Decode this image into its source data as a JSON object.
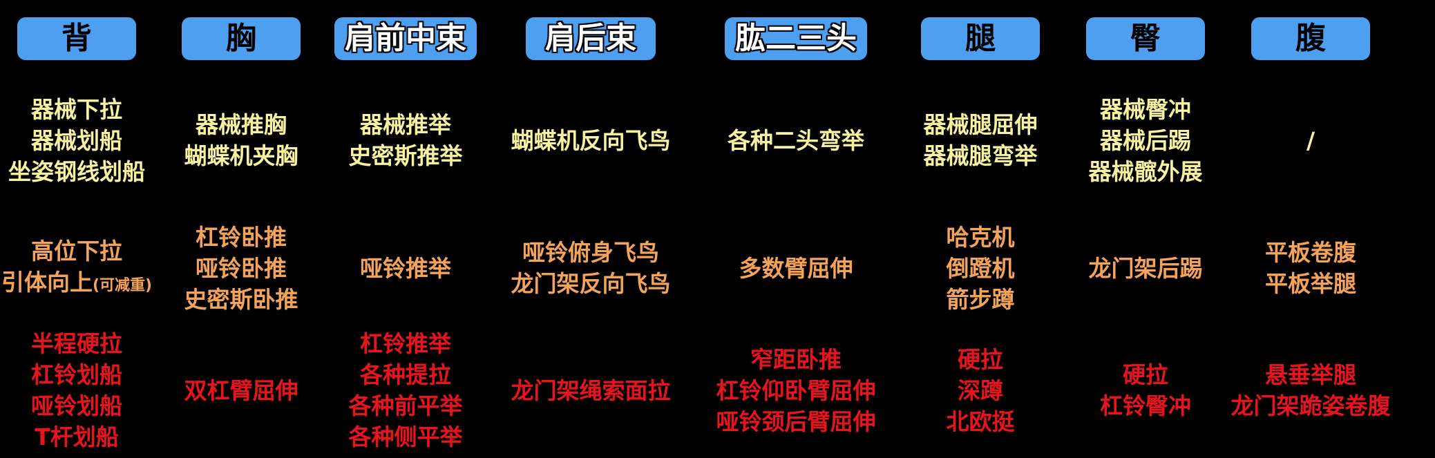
{
  "colors": {
    "background": "#000000",
    "header_bg": "#4f9ff0",
    "row1_text": "#f7f1a0",
    "row2_text": "#f4a45a",
    "row3_text": "#e8141d"
  },
  "columns": [
    {
      "header": "背",
      "row1": [
        "器械下拉",
        "器械划船",
        "坐姿钢线划船"
      ],
      "row2": [
        "高位下拉",
        "引体向上"
      ],
      "row2_note": "(可减重)",
      "row3": [
        "半程硬拉",
        "杠铃划船",
        "哑铃划船",
        "T杆划船"
      ]
    },
    {
      "header": "胸",
      "row1": [
        "器械推胸",
        "蝴蝶机夹胸"
      ],
      "row2": [
        "杠铃卧推",
        "哑铃卧推",
        "史密斯卧推"
      ],
      "row3": [
        "双杠臂屈伸"
      ]
    },
    {
      "header": "肩前中束",
      "row1": [
        "器械推举",
        "史密斯推举"
      ],
      "row2": [
        "哑铃推举"
      ],
      "row3": [
        "杠铃推举",
        "各种提拉",
        "各种前平举",
        "各种侧平举"
      ]
    },
    {
      "header": "肩后束",
      "row1": [
        "蝴蝶机反向飞鸟"
      ],
      "row2": [
        "哑铃俯身飞鸟",
        "龙门架反向飞鸟"
      ],
      "row3": [
        "龙门架绳索面拉"
      ]
    },
    {
      "header": "肱二三头",
      "row1": [
        "各种二头弯举"
      ],
      "row2": [
        "多数臂屈伸"
      ],
      "row3": [
        "窄距卧推",
        "杠铃仰卧臂屈伸",
        "哑铃颈后臂屈伸"
      ]
    },
    {
      "header": "腿",
      "row1": [
        "器械腿屈伸",
        "器械腿弯举"
      ],
      "row2": [
        "哈克机",
        "倒蹬机",
        "箭步蹲"
      ],
      "row3": [
        "硬拉",
        "深蹲",
        "北欧挺"
      ]
    },
    {
      "header": "臀",
      "row1": [
        "器械臀冲",
        "器械后踢",
        "器械髋外展"
      ],
      "row2": [
        "龙门架后踢"
      ],
      "row3": [
        "硬拉",
        "杠铃臀冲"
      ]
    },
    {
      "header": "腹",
      "row1": [
        "/"
      ],
      "row2": [
        "平板卷腹",
        "平板举腿"
      ],
      "row3": [
        "悬垂举腿",
        "龙门架跪姿卷腹"
      ]
    }
  ]
}
